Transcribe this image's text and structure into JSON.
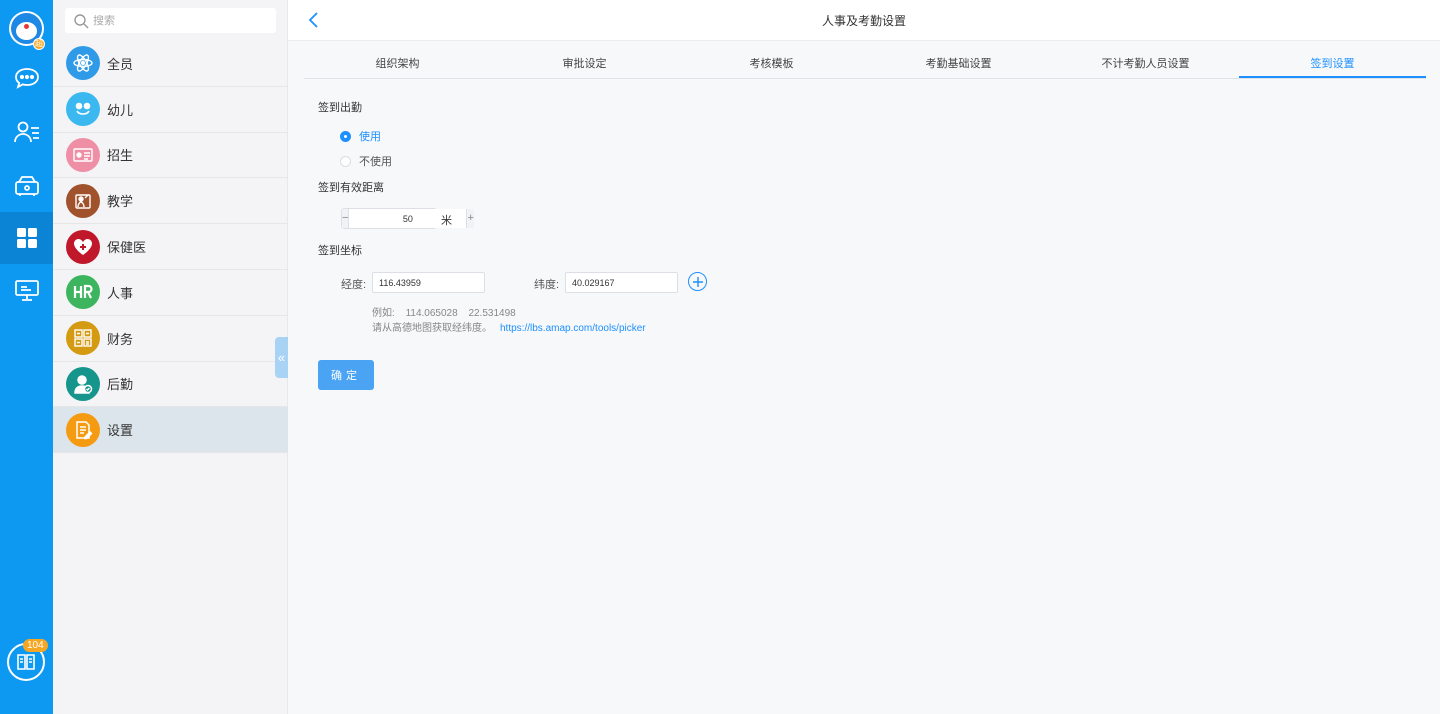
{
  "rail": {
    "avatar_badge": "超",
    "items": [
      {
        "name": "chat",
        "icon": "chat-icon"
      },
      {
        "name": "contacts",
        "icon": "contacts-icon"
      },
      {
        "name": "device",
        "icon": "device-icon"
      },
      {
        "name": "apps",
        "icon": "grid-icon",
        "active": true
      },
      {
        "name": "screen",
        "icon": "monitor-icon"
      }
    ],
    "bottom_badge": "104"
  },
  "sidebar": {
    "search_placeholder": "搜索",
    "items": [
      {
        "label": "全员",
        "color": "#2f9be8",
        "icon": "atom-icon"
      },
      {
        "label": "幼儿",
        "color": "#3bb8f0",
        "icon": "smile-icon"
      },
      {
        "label": "招生",
        "color": "#ee8fa6",
        "icon": "card-icon"
      },
      {
        "label": "教学",
        "color": "#a0522d",
        "icon": "teacher-icon"
      },
      {
        "label": "保健医",
        "color": "#c0182a",
        "icon": "heart-plus-icon"
      },
      {
        "label": "人事",
        "color": "#3cb55e",
        "icon": "hr-icon"
      },
      {
        "label": "财务",
        "color": "#d49a12",
        "icon": "calculator-icon"
      },
      {
        "label": "后勤",
        "color": "#15958c",
        "icon": "user-check-icon"
      },
      {
        "label": "设置",
        "color": "#f59b12",
        "icon": "edit-doc-icon",
        "active": true
      }
    ]
  },
  "header": {
    "title": "人事及考勤设置"
  },
  "tabs": [
    {
      "label": "组织架构"
    },
    {
      "label": "审批设定"
    },
    {
      "label": "考核模板"
    },
    {
      "label": "考勤基础设置"
    },
    {
      "label": "不计考勤人员设置"
    },
    {
      "label": "签到设置",
      "active": true
    }
  ],
  "checkin": {
    "section_title": "签到出勤",
    "option_use": "使用",
    "option_not_use": "不使用",
    "selected": "使用",
    "distance_title": "签到有效距离",
    "distance_value": "50",
    "distance_minus": "−",
    "distance_plus": "+",
    "distance_unit": "米",
    "coord_title": "签到坐标",
    "lng_label": "经度:",
    "lng_value": "116.43959",
    "lat_label": "纬度:",
    "lat_value": "40.029167",
    "example_label": "例如:",
    "example_lng": "114.065028",
    "example_lat": "22.531498",
    "hint_text": "请从高德地图获取经纬度。",
    "hint_link": "https://lbs.amap.com/tools/picker",
    "confirm_label": "确定"
  },
  "colors": {
    "rail": "#0d98f2",
    "accent": "#1e90ff",
    "confirm": "#4aa3f3"
  }
}
